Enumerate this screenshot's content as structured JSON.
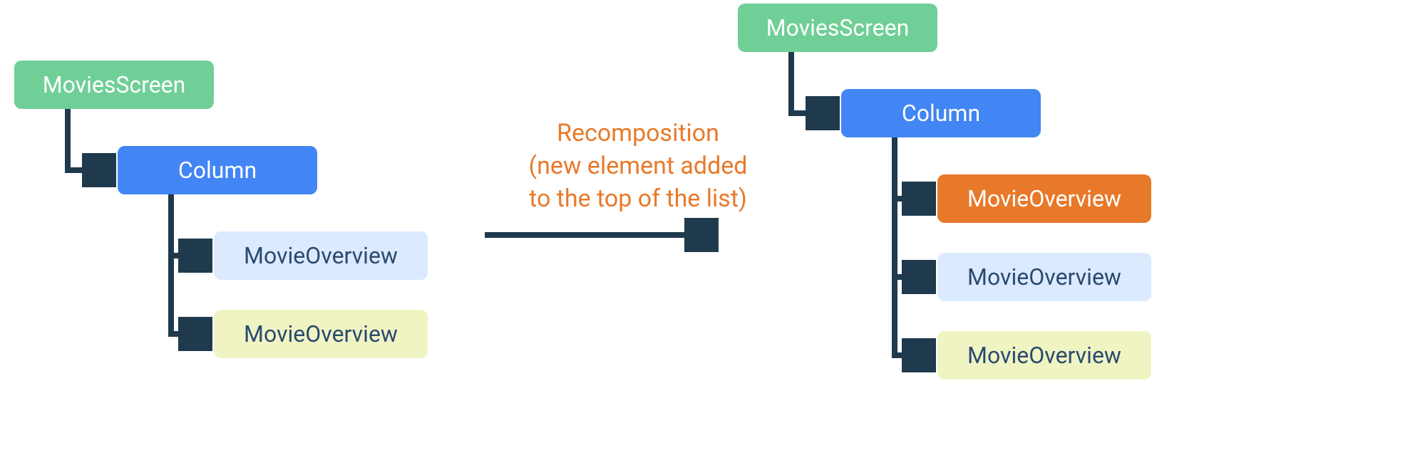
{
  "left": {
    "root": "MoviesScreen",
    "column": "Column",
    "items": [
      "MovieOverview",
      "MovieOverview"
    ]
  },
  "caption": {
    "line1": "Recomposition",
    "line2": "(new element added",
    "line3": "to the top of the list)"
  },
  "right": {
    "root": "MoviesScreen",
    "column": "Column",
    "items": [
      "MovieOverview",
      "MovieOverview",
      "MovieOverview"
    ]
  },
  "colors": {
    "green": "#6fcf97",
    "blue": "#4285f4",
    "lightblue": "#dbeafe",
    "yellow": "#f0f4c3",
    "orange": "#e8792a",
    "arrow": "#1f3a4d"
  }
}
